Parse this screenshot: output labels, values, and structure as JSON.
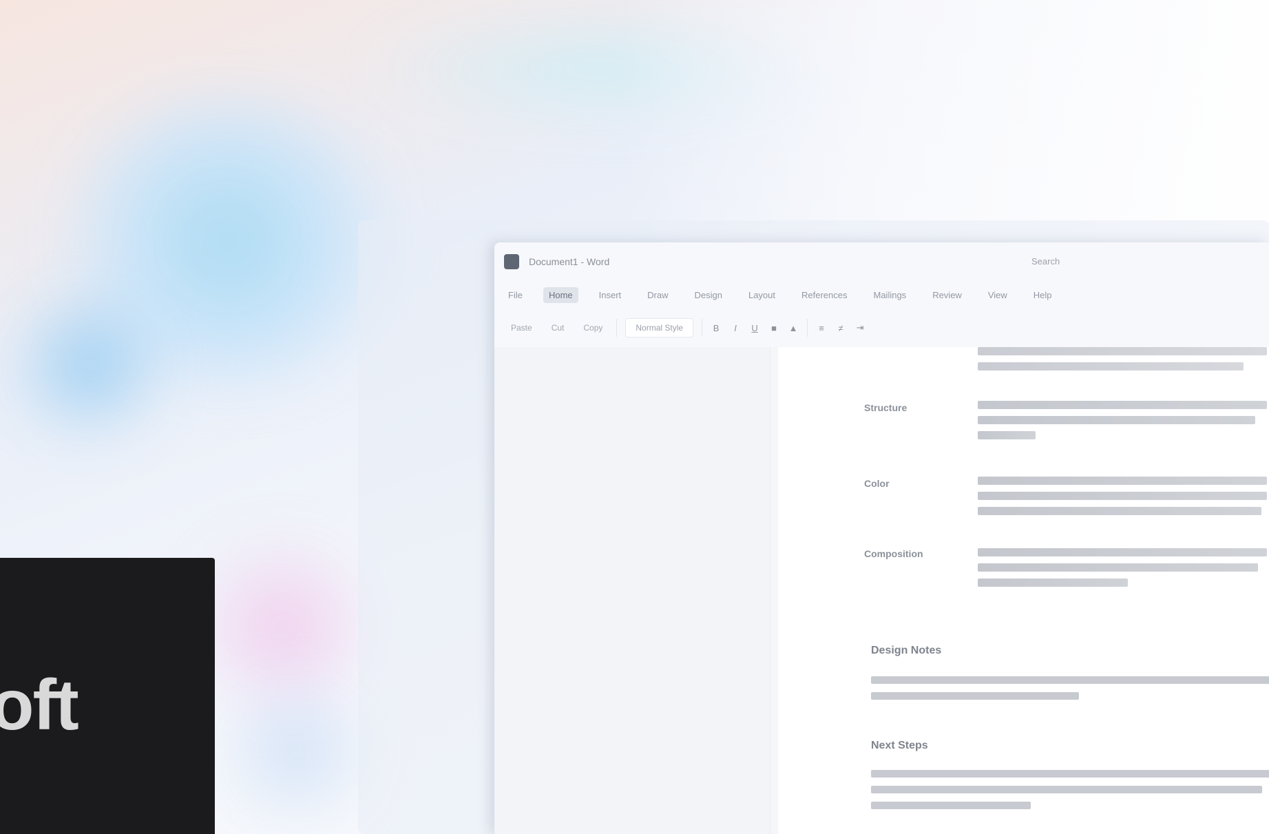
{
  "window": {
    "document_title": "Document1 - Word",
    "center_title": "Search"
  },
  "menu": {
    "items": [
      "File",
      "Home",
      "Insert",
      "Draw",
      "Design",
      "Layout",
      "References",
      "Mailings",
      "Review",
      "View",
      "Help"
    ],
    "active_index": 1
  },
  "toolbar": {
    "paste_label": "Paste",
    "cut_label": "Cut",
    "copy_label": "Copy",
    "style_label": "Normal Style",
    "icons": [
      "bold-icon",
      "italic-icon",
      "underline-icon",
      "highlight-icon",
      "font-color-icon",
      "list-icon",
      "align-icon",
      "indent-icon"
    ]
  },
  "document": {
    "terms": [
      {
        "term": "Structure"
      },
      {
        "term": "Color"
      },
      {
        "term": "Composition"
      }
    ],
    "sections": [
      {
        "heading": "Design Notes"
      },
      {
        "heading": "Next Steps"
      }
    ]
  },
  "logo": {
    "text": "oft"
  },
  "colors": {
    "logo_bg": "#1b1b1d",
    "window_bg": "#fdfdfe",
    "menu_active": "#dfe3ea"
  }
}
